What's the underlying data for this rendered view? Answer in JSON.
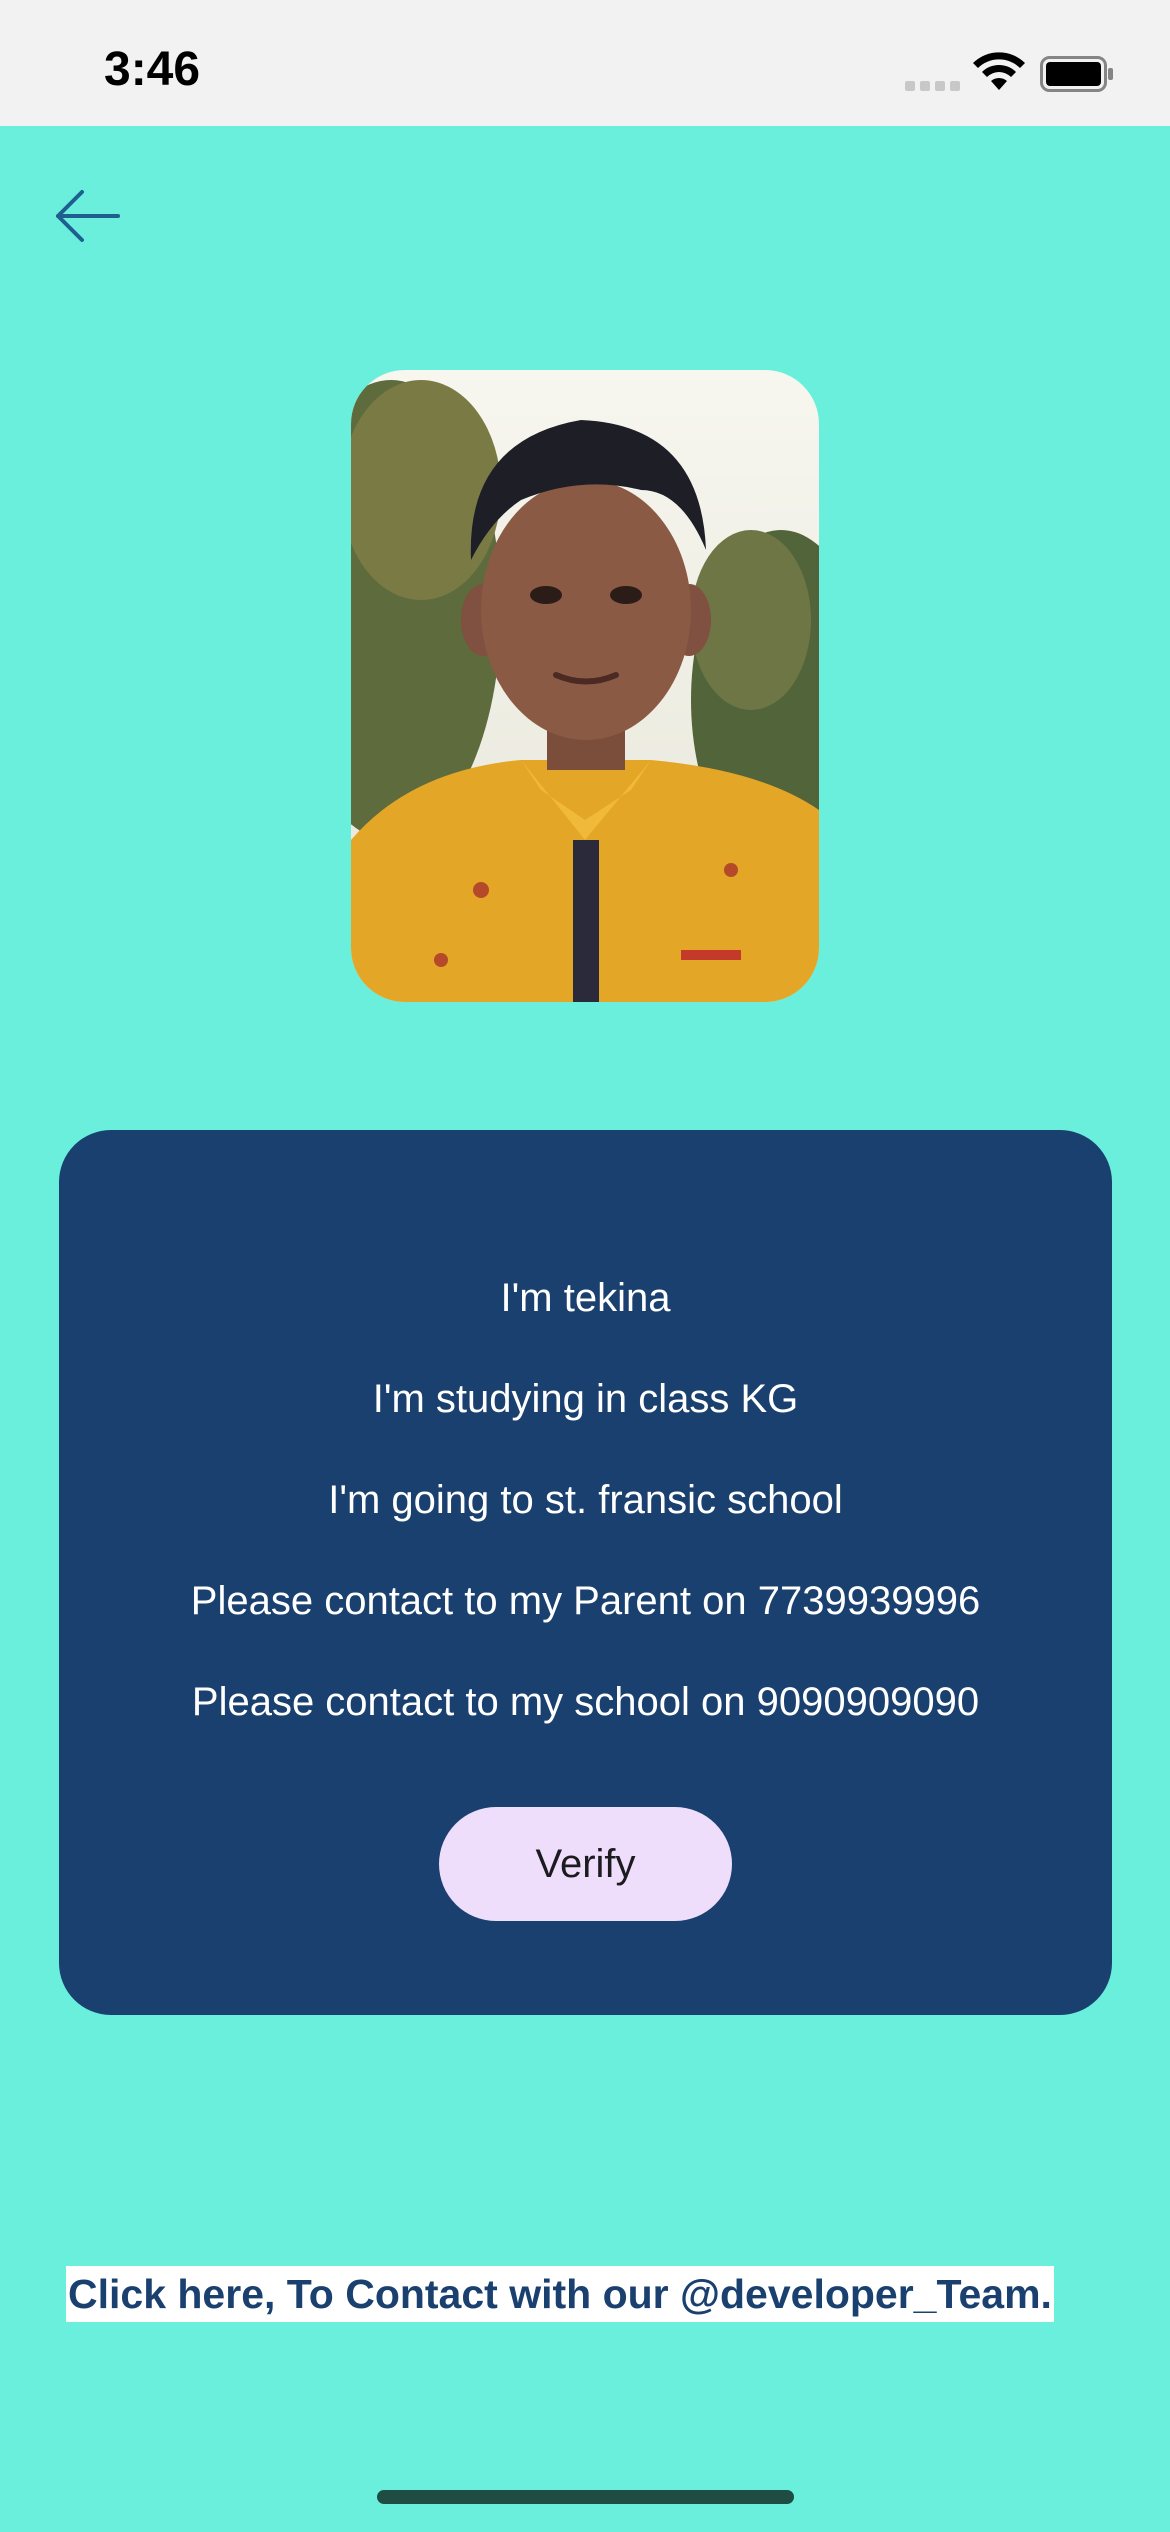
{
  "status_bar": {
    "time": "3:46",
    "wifi_icon": "wifi-icon",
    "battery_icon": "battery-icon"
  },
  "header": {
    "back_icon": "arrow-left-icon"
  },
  "profile": {
    "photo": "child-photo"
  },
  "info": {
    "name_line": "I'm  tekina",
    "class_line": "I'm studying in class KG",
    "school_line": "I'm going to st. fransic school",
    "parent_line": "Please contact to my Parent on 7739939996",
    "school_contact_line": "Please contact to my school on 9090909090",
    "verify_label": "Verify"
  },
  "footer": {
    "contact_link": "Click here, To Contact with our @developer_Team."
  },
  "colors": {
    "background": "#69efdc",
    "card": "#1a406f",
    "button": "#efdefb",
    "link_text": "#1a406f"
  }
}
